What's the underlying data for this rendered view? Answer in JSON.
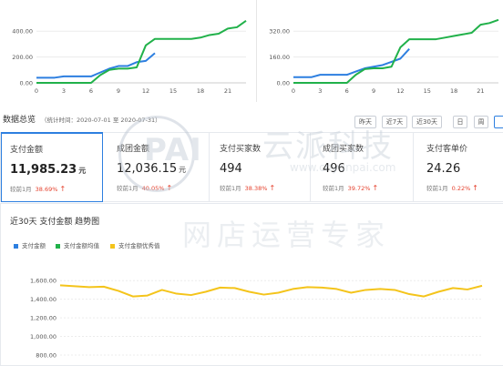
{
  "colors": {
    "blue": "#2d7fe0",
    "green": "#21b14a",
    "yellow": "#f4c41b",
    "red": "#e5412d",
    "grid": "#e8e8e8"
  },
  "watermark": {
    "logo": "PAI",
    "cn": "云派科技",
    "url": "www.cnyunpai.com",
    "slogan": "网店运营专家"
  },
  "overview": {
    "title": "数据总览",
    "period": "（统计时间：2020-07-01 至 2020-07-31）",
    "buttons": [
      "昨天",
      "近7天",
      "近30天",
      "日",
      "周",
      ""
    ]
  },
  "kpis": [
    {
      "label": "支付金额",
      "value": "11,985.23",
      "unit": "元",
      "compare_label": "较前1月",
      "change": "38.69%"
    },
    {
      "label": "成团金额",
      "value": "12,036.15",
      "unit": "元",
      "compare_label": "较前1月",
      "change": "40.05%"
    },
    {
      "label": "支付买家数",
      "value": "494",
      "unit": "",
      "compare_label": "较前1月",
      "change": "38.38%"
    },
    {
      "label": "成团买家数",
      "value": "496",
      "unit": "",
      "compare_label": "较前1月",
      "change": "39.72%"
    },
    {
      "label": "支付客单价",
      "value": "24.26",
      "unit": "",
      "compare_label": "较前1月",
      "change": "0.22%"
    }
  ],
  "trend": {
    "title": "近30天 支付金额 趋势图",
    "legend": [
      {
        "name": "支付金额",
        "color": "#2d7fe0"
      },
      {
        "name": "支付金额均值",
        "color": "#21b14a"
      },
      {
        "name": "支付金额优秀值",
        "color": "#f4c41b"
      }
    ]
  },
  "chart_data": [
    {
      "type": "line",
      "ylim": [
        0,
        500
      ],
      "yticks": [
        "0.00",
        "200.00",
        "400.00"
      ],
      "yticks_values": [
        0,
        200,
        400
      ],
      "xticks": [
        "0",
        "3",
        "6",
        "9",
        "12",
        "15",
        "18",
        "21"
      ],
      "xticks_values": [
        0,
        3,
        6,
        9,
        12,
        15,
        18,
        21
      ],
      "xlim": [
        0,
        23
      ],
      "series": [
        {
          "color": "#2d7fe0",
          "x": [
            0,
            1,
            2,
            3,
            4,
            5,
            6,
            7,
            8,
            9,
            10,
            11,
            12,
            13
          ],
          "values": [
            40,
            40,
            40,
            50,
            50,
            50,
            50,
            80,
            110,
            130,
            130,
            160,
            170,
            230
          ]
        },
        {
          "color": "#21b14a",
          "x": [
            0,
            1,
            2,
            3,
            4,
            5,
            6,
            7,
            8,
            9,
            10,
            11,
            12,
            13,
            14,
            15,
            16,
            17,
            18,
            19,
            20,
            21,
            22,
            23
          ],
          "values": [
            0,
            0,
            0,
            0,
            0,
            0,
            0,
            60,
            100,
            110,
            110,
            120,
            290,
            340,
            340,
            340,
            340,
            340,
            350,
            370,
            380,
            420,
            430,
            480
          ]
        }
      ]
    },
    {
      "type": "line",
      "ylim": [
        0,
        400
      ],
      "yticks": [
        "0.00",
        "160.00",
        "320.00"
      ],
      "yticks_values": [
        0,
        160,
        320
      ],
      "xticks": [
        "0",
        "3",
        "6",
        "9",
        "12",
        "15",
        "18",
        "21"
      ],
      "xticks_values": [
        0,
        3,
        6,
        9,
        12,
        15,
        18,
        21
      ],
      "xlim": [
        0,
        23
      ],
      "series": [
        {
          "color": "#2d7fe0",
          "x": [
            0,
            1,
            2,
            3,
            4,
            5,
            6,
            7,
            8,
            9,
            10,
            11,
            12,
            13
          ],
          "values": [
            35,
            35,
            35,
            50,
            50,
            50,
            50,
            70,
            90,
            100,
            110,
            130,
            150,
            210
          ]
        },
        {
          "color": "#21b14a",
          "x": [
            0,
            1,
            2,
            3,
            4,
            5,
            6,
            7,
            8,
            9,
            10,
            11,
            12,
            13,
            14,
            15,
            16,
            17,
            18,
            19,
            20,
            21,
            22,
            23
          ],
          "values": [
            0,
            0,
            0,
            0,
            0,
            0,
            0,
            50,
            85,
            90,
            90,
            100,
            220,
            270,
            270,
            270,
            270,
            280,
            290,
            300,
            310,
            360,
            370,
            390
          ]
        }
      ]
    },
    {
      "type": "line",
      "ylim": [
        800,
        1700
      ],
      "yticks": [
        "800.00",
        "1,000.00",
        "1,200.00",
        "1,400.00",
        "1,600.00"
      ],
      "yticks_values": [
        800,
        1000,
        1200,
        1400,
        1600
      ],
      "xlim": [
        0,
        29
      ],
      "series": [
        {
          "name": "支付金额优秀值",
          "color": "#f4c41b",
          "x": [
            0,
            1,
            2,
            3,
            4,
            5,
            6,
            7,
            8,
            9,
            10,
            11,
            12,
            13,
            14,
            15,
            16,
            17,
            18,
            19,
            20,
            21,
            22,
            23,
            24,
            25,
            26,
            27,
            28,
            29
          ],
          "values": [
            1550,
            1540,
            1530,
            1535,
            1490,
            1430,
            1440,
            1500,
            1460,
            1445,
            1480,
            1525,
            1520,
            1480,
            1450,
            1470,
            1510,
            1530,
            1525,
            1510,
            1470,
            1500,
            1510,
            1500,
            1455,
            1430,
            1480,
            1520,
            1505,
            1545
          ]
        }
      ]
    }
  ]
}
